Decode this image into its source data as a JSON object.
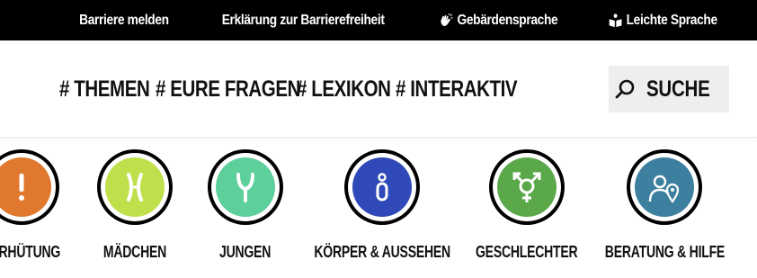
{
  "topbar": {
    "report_barrier": "Barriere melden",
    "accessibility_statement": "Erklärung zur Barrierefreiheit",
    "sign_language": "Gebärdensprache",
    "easy_language": "Leichte Sprache"
  },
  "nav": {
    "items": [
      "# THEMEN",
      "# EURE FRAGEN",
      "# LEXIKON",
      "# INTERAKTIV"
    ],
    "search_label": "SUCHE"
  },
  "categories": [
    {
      "label": "VERHÜTUNG",
      "color": "#e0782e",
      "icon": "exclamation-icon"
    },
    {
      "label": "MÄDCHEN",
      "color": "#bfe04a",
      "icon": "x-chromosome-icon"
    },
    {
      "label": "JUNGEN",
      "color": "#5ccf9b",
      "icon": "y-chromosome-icon"
    },
    {
      "label": "KÖRPER & AUSSEHEN",
      "color": "#2f49b8",
      "icon": "body-icon"
    },
    {
      "label": "GESCHLECHTER",
      "color": "#5aa84a",
      "icon": "gender-symbol-icon"
    },
    {
      "label": "BERATUNG & HILFE",
      "color": "#3d7f9e",
      "icon": "counseling-location-icon"
    }
  ]
}
